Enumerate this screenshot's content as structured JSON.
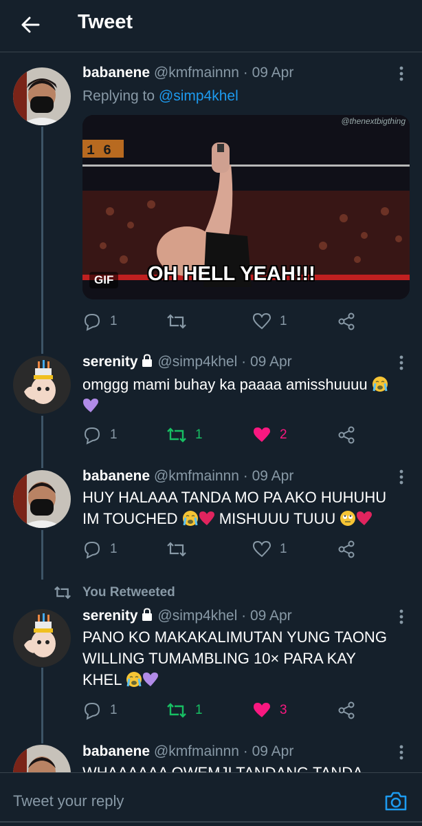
{
  "header": {
    "title": "Tweet"
  },
  "tweets": [
    {
      "name": "babanene",
      "handle": "@kmfmainnn",
      "date": "09 Apr",
      "replying_prefix": "Replying to",
      "replying_to": "@simp4khel",
      "media": {
        "badge": "GIF",
        "caption": "OH HELL YEAH!!!",
        "watermark": "@thenextbigthing",
        "score": "1 6"
      },
      "replies": "1",
      "retweets": "",
      "likes": "1"
    },
    {
      "name": "serenity",
      "handle": "@simp4khel",
      "date": "09 Apr",
      "text": "omggg mami buhay ka paaaa amisshuuuu",
      "replies": "1",
      "retweets": "1",
      "likes": "2",
      "retweeted": true,
      "liked": true
    },
    {
      "name": "babanene",
      "handle": "@kmfmainnn",
      "date": "09 Apr",
      "text_line1": "HUY HALAAA TANDA MO PA AKO HUHUHU",
      "text_line2a": "IM TOUCHED",
      "text_line2b": "MISHUUU TUUU",
      "replies": "1",
      "retweets": "",
      "likes": "1"
    },
    {
      "retweet_note": "You Retweeted",
      "name": "serenity",
      "handle": "@simp4khel",
      "date": "09 Apr",
      "text_line1": "PANO KO MAKAKALIMUTAN YUNG TAONG",
      "text_line2": "WILLING TUMAMBLING 10× PARA KAY",
      "text_line3": "KHEL",
      "replies": "1",
      "retweets": "1",
      "likes": "3",
      "retweeted": true,
      "liked": true
    },
    {
      "name": "babanene",
      "handle": "@kmfmainnn",
      "date": "09 Apr",
      "text_partial": "WHAAAAAA OWEMJI TANDANG TANDA"
    }
  ],
  "reply_bar": {
    "placeholder": "Tweet your reply"
  },
  "colors": {
    "background": "#15202b",
    "accent": "#1d9bf0",
    "retweet_green": "#17bf63",
    "like_pink": "#f91880",
    "secondary_text": "#8899a6"
  }
}
